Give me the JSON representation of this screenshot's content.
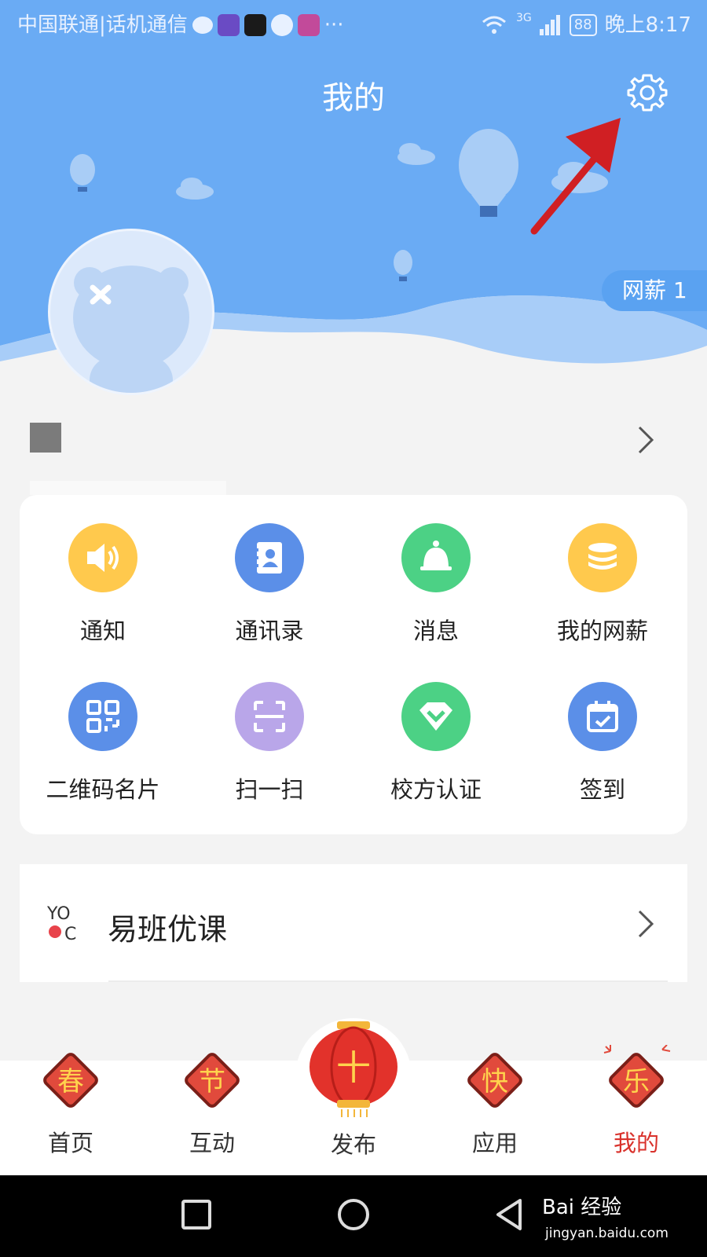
{
  "status_bar": {
    "carrier": "中国联通|话机通信",
    "network": "3G",
    "battery": "88",
    "time": "晚上8:17"
  },
  "header": {
    "title": "我的",
    "salary_badge": "网薪 1"
  },
  "grid": [
    {
      "label": "通知",
      "icon": "speaker-icon",
      "color": "#ffc94d"
    },
    {
      "label": "通讯录",
      "icon": "contacts-icon",
      "color": "#5b8fe8"
    },
    {
      "label": "消息",
      "icon": "bell-icon",
      "color": "#4cd185"
    },
    {
      "label": "我的网薪",
      "icon": "coins-icon",
      "color": "#ffc94d"
    },
    {
      "label": "二维码名片",
      "icon": "qrcode-icon",
      "color": "#5b8fe8"
    },
    {
      "label": "扫一扫",
      "icon": "scan-icon",
      "color": "#b9a6e9"
    },
    {
      "label": "校方认证",
      "icon": "verify-icon",
      "color": "#4cd185"
    },
    {
      "label": "签到",
      "icon": "calendar-check-icon",
      "color": "#5b8fe8"
    }
  ],
  "course": {
    "logo": "YO OC",
    "title": "易班优课"
  },
  "tabs": [
    {
      "label": "首页",
      "badge": "春",
      "active": false
    },
    {
      "label": "互动",
      "badge": "节",
      "active": false
    },
    {
      "label": "发布",
      "badge": "十",
      "active": false
    },
    {
      "label": "应用",
      "badge": "快",
      "active": false
    },
    {
      "label": "我的",
      "badge": "乐",
      "active": true
    }
  ],
  "watermark": {
    "brand": "Bai 经验",
    "url": "jingyan.baidu.com"
  },
  "colors": {
    "header_blue": "#6aabf4",
    "active_tab": "#d9322c"
  }
}
